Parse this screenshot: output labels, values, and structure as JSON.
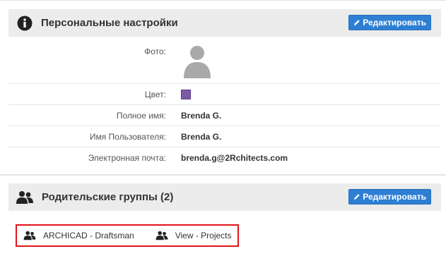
{
  "personal": {
    "title": "Персональные настройки",
    "edit_label": "Редактировать",
    "fields": {
      "photo_label": "Фото:",
      "color_label": "Цвет:",
      "color_value": "#7b5aa6",
      "fullname_label": "Полное имя:",
      "fullname_value": "Brenda G.",
      "username_label": "Имя Пользователя:",
      "username_value": "Brenda G.",
      "email_label": "Электронная почта:",
      "email_value": "brenda.g@2Rchitects.com"
    }
  },
  "groups": {
    "title": "Родительские группы (2)",
    "edit_label": "Редактировать",
    "items": [
      {
        "label": "ARCHICAD - Draftsman",
        "icon": "users-icon"
      },
      {
        "label": "View - Projects",
        "icon": "users-icon"
      }
    ]
  },
  "icons": {
    "personal_header": "info-circle-icon",
    "groups_header": "users-icon",
    "edit": "pencil-icon",
    "avatar": "user-avatar-placeholder"
  },
  "colors": {
    "accent": "#2d7fd3",
    "highlight_border": "#e0141b",
    "header_bg": "#ececec"
  }
}
